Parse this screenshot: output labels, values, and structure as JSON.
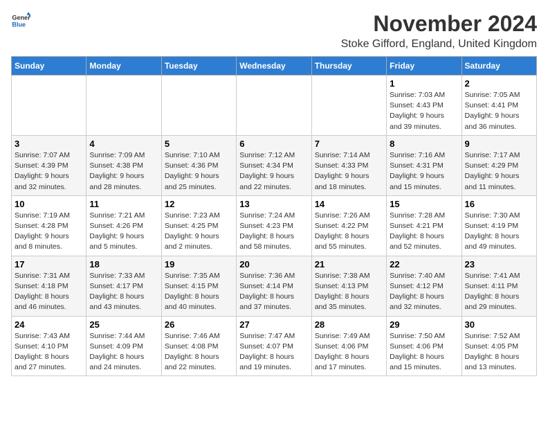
{
  "logo": {
    "general": "General",
    "blue": "Blue"
  },
  "title": "November 2024",
  "subtitle": "Stoke Gifford, England, United Kingdom",
  "weekdays": [
    "Sunday",
    "Monday",
    "Tuesday",
    "Wednesday",
    "Thursday",
    "Friday",
    "Saturday"
  ],
  "weeks": [
    [
      {
        "day": "",
        "info": ""
      },
      {
        "day": "",
        "info": ""
      },
      {
        "day": "",
        "info": ""
      },
      {
        "day": "",
        "info": ""
      },
      {
        "day": "",
        "info": ""
      },
      {
        "day": "1",
        "info": "Sunrise: 7:03 AM\nSunset: 4:43 PM\nDaylight: 9 hours\nand 39 minutes."
      },
      {
        "day": "2",
        "info": "Sunrise: 7:05 AM\nSunset: 4:41 PM\nDaylight: 9 hours\nand 36 minutes."
      }
    ],
    [
      {
        "day": "3",
        "info": "Sunrise: 7:07 AM\nSunset: 4:39 PM\nDaylight: 9 hours\nand 32 minutes."
      },
      {
        "day": "4",
        "info": "Sunrise: 7:09 AM\nSunset: 4:38 PM\nDaylight: 9 hours\nand 28 minutes."
      },
      {
        "day": "5",
        "info": "Sunrise: 7:10 AM\nSunset: 4:36 PM\nDaylight: 9 hours\nand 25 minutes."
      },
      {
        "day": "6",
        "info": "Sunrise: 7:12 AM\nSunset: 4:34 PM\nDaylight: 9 hours\nand 22 minutes."
      },
      {
        "day": "7",
        "info": "Sunrise: 7:14 AM\nSunset: 4:33 PM\nDaylight: 9 hours\nand 18 minutes."
      },
      {
        "day": "8",
        "info": "Sunrise: 7:16 AM\nSunset: 4:31 PM\nDaylight: 9 hours\nand 15 minutes."
      },
      {
        "day": "9",
        "info": "Sunrise: 7:17 AM\nSunset: 4:29 PM\nDaylight: 9 hours\nand 11 minutes."
      }
    ],
    [
      {
        "day": "10",
        "info": "Sunrise: 7:19 AM\nSunset: 4:28 PM\nDaylight: 9 hours\nand 8 minutes."
      },
      {
        "day": "11",
        "info": "Sunrise: 7:21 AM\nSunset: 4:26 PM\nDaylight: 9 hours\nand 5 minutes."
      },
      {
        "day": "12",
        "info": "Sunrise: 7:23 AM\nSunset: 4:25 PM\nDaylight: 9 hours\nand 2 minutes."
      },
      {
        "day": "13",
        "info": "Sunrise: 7:24 AM\nSunset: 4:23 PM\nDaylight: 8 hours\nand 58 minutes."
      },
      {
        "day": "14",
        "info": "Sunrise: 7:26 AM\nSunset: 4:22 PM\nDaylight: 8 hours\nand 55 minutes."
      },
      {
        "day": "15",
        "info": "Sunrise: 7:28 AM\nSunset: 4:21 PM\nDaylight: 8 hours\nand 52 minutes."
      },
      {
        "day": "16",
        "info": "Sunrise: 7:30 AM\nSunset: 4:19 PM\nDaylight: 8 hours\nand 49 minutes."
      }
    ],
    [
      {
        "day": "17",
        "info": "Sunrise: 7:31 AM\nSunset: 4:18 PM\nDaylight: 8 hours\nand 46 minutes."
      },
      {
        "day": "18",
        "info": "Sunrise: 7:33 AM\nSunset: 4:17 PM\nDaylight: 8 hours\nand 43 minutes."
      },
      {
        "day": "19",
        "info": "Sunrise: 7:35 AM\nSunset: 4:15 PM\nDaylight: 8 hours\nand 40 minutes."
      },
      {
        "day": "20",
        "info": "Sunrise: 7:36 AM\nSunset: 4:14 PM\nDaylight: 8 hours\nand 37 minutes."
      },
      {
        "day": "21",
        "info": "Sunrise: 7:38 AM\nSunset: 4:13 PM\nDaylight: 8 hours\nand 35 minutes."
      },
      {
        "day": "22",
        "info": "Sunrise: 7:40 AM\nSunset: 4:12 PM\nDaylight: 8 hours\nand 32 minutes."
      },
      {
        "day": "23",
        "info": "Sunrise: 7:41 AM\nSunset: 4:11 PM\nDaylight: 8 hours\nand 29 minutes."
      }
    ],
    [
      {
        "day": "24",
        "info": "Sunrise: 7:43 AM\nSunset: 4:10 PM\nDaylight: 8 hours\nand 27 minutes."
      },
      {
        "day": "25",
        "info": "Sunrise: 7:44 AM\nSunset: 4:09 PM\nDaylight: 8 hours\nand 24 minutes."
      },
      {
        "day": "26",
        "info": "Sunrise: 7:46 AM\nSunset: 4:08 PM\nDaylight: 8 hours\nand 22 minutes."
      },
      {
        "day": "27",
        "info": "Sunrise: 7:47 AM\nSunset: 4:07 PM\nDaylight: 8 hours\nand 19 minutes."
      },
      {
        "day": "28",
        "info": "Sunrise: 7:49 AM\nSunset: 4:06 PM\nDaylight: 8 hours\nand 17 minutes."
      },
      {
        "day": "29",
        "info": "Sunrise: 7:50 AM\nSunset: 4:06 PM\nDaylight: 8 hours\nand 15 minutes."
      },
      {
        "day": "30",
        "info": "Sunrise: 7:52 AM\nSunset: 4:05 PM\nDaylight: 8 hours\nand 13 minutes."
      }
    ]
  ]
}
